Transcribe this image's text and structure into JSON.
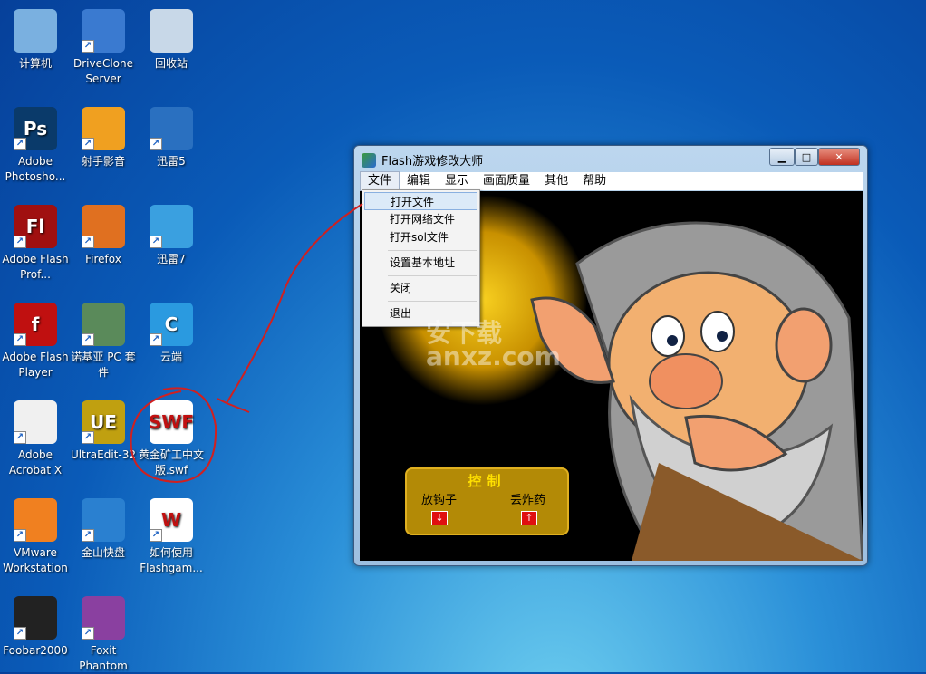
{
  "desktop": {
    "icons": [
      {
        "label": "计算机",
        "glyph": "computer-icon",
        "color": "#7ab0e0"
      },
      {
        "label": "DriveClone Server",
        "glyph": "driveclone-icon",
        "color": "#3a7ad0"
      },
      {
        "label": "回收站",
        "glyph": "recycle-bin-icon",
        "color": "#c8d8e8"
      },
      {
        "label": "Adobe Photosho...",
        "glyph": "Ps",
        "color": "#0a3a6a"
      },
      {
        "label": "射手影音",
        "glyph": "splayer-icon",
        "color": "#f0a020"
      },
      {
        "label": "迅雷5",
        "glyph": "thunder-icon",
        "color": "#2a70c0"
      },
      {
        "label": "Adobe Flash Prof...",
        "glyph": "Fl",
        "color": "#a01010"
      },
      {
        "label": "Firefox",
        "glyph": "firefox-icon",
        "color": "#e07020"
      },
      {
        "label": "迅雷7",
        "glyph": "thunder7-icon",
        "color": "#3aa0e0"
      },
      {
        "label": "Adobe Flash Player",
        "glyph": "f",
        "color": "#c01010"
      },
      {
        "label": "诺基亚 PC 套件",
        "glyph": "nokia-icon",
        "color": "#5a8a5a"
      },
      {
        "label": "云端",
        "glyph": "C",
        "color": "#2a9ae0"
      },
      {
        "label": "Adobe Acrobat X",
        "glyph": "acrobat-icon",
        "color": "#f0f0f0"
      },
      {
        "label": "UltraEdit-32",
        "glyph": "UE",
        "color": "#c0a010"
      },
      {
        "label": "黄金矿工中文版.swf",
        "glyph": "SWF",
        "color": "#ffffff"
      },
      {
        "label": "VMware Workstation",
        "glyph": "vmware-icon",
        "color": "#f08020"
      },
      {
        "label": "金山快盘",
        "glyph": "kuaipan-icon",
        "color": "#2a80d0"
      },
      {
        "label": "如何使用Flashgam...",
        "glyph": "W",
        "color": "#ffffff"
      },
      {
        "label": "Foobar2000",
        "glyph": "foobar-icon",
        "color": "#222222"
      },
      {
        "label": "Foxit Phantom",
        "glyph": "foxit-icon",
        "color": "#8a40a0"
      }
    ]
  },
  "window": {
    "title": "Flash游戏修改大师",
    "menu": [
      "文件",
      "编辑",
      "显示",
      "画面质量",
      "其他",
      "帮助"
    ],
    "dropdown": [
      "打开文件",
      "打开网络文件",
      "打开sol文件",
      "设置基本地址",
      "关闭",
      "退出"
    ],
    "game": {
      "panel_title": "控制",
      "hook_label": "放钩子",
      "bomb_label": "丢炸药"
    }
  },
  "watermark": "安下载 anxz.com",
  "annotation_color": "#d02020"
}
